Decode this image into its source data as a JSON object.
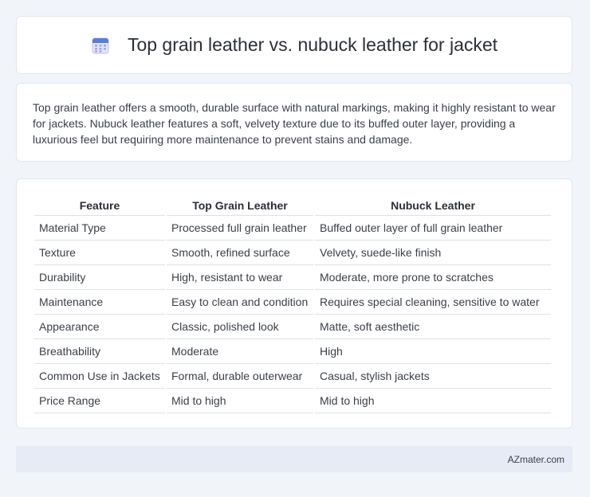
{
  "header": {
    "title": "Top grain leather vs. nubuck leather for jacket",
    "icon": "calendar-icon"
  },
  "summary": {
    "text": "Top grain leather offers a smooth, durable surface with natural markings, making it highly resistant to wear for jackets. Nubuck leather features a soft, velvety texture due to its buffed outer layer, providing a luxurious feel but requiring more maintenance to prevent stains and damage."
  },
  "table": {
    "headers": [
      "Feature",
      "Top Grain Leather",
      "Nubuck Leather"
    ],
    "rows": [
      [
        "Material Type",
        "Processed full grain leather",
        "Buffed outer layer of full grain leather"
      ],
      [
        "Texture",
        "Smooth, refined surface",
        "Velvety, suede-like finish"
      ],
      [
        "Durability",
        "High, resistant to wear",
        "Moderate, more prone to scratches"
      ],
      [
        "Maintenance",
        "Easy to clean and condition",
        "Requires special cleaning, sensitive to water"
      ],
      [
        "Appearance",
        "Classic, polished look",
        "Matte, soft aesthetic"
      ],
      [
        "Breathability",
        "Moderate",
        "High"
      ],
      [
        "Common Use in Jackets",
        "Formal, durable outerwear",
        "Casual, stylish jackets"
      ],
      [
        "Price Range",
        "Mid to high",
        "Mid to high"
      ]
    ]
  },
  "footer": {
    "brand": "AZmater.com"
  }
}
